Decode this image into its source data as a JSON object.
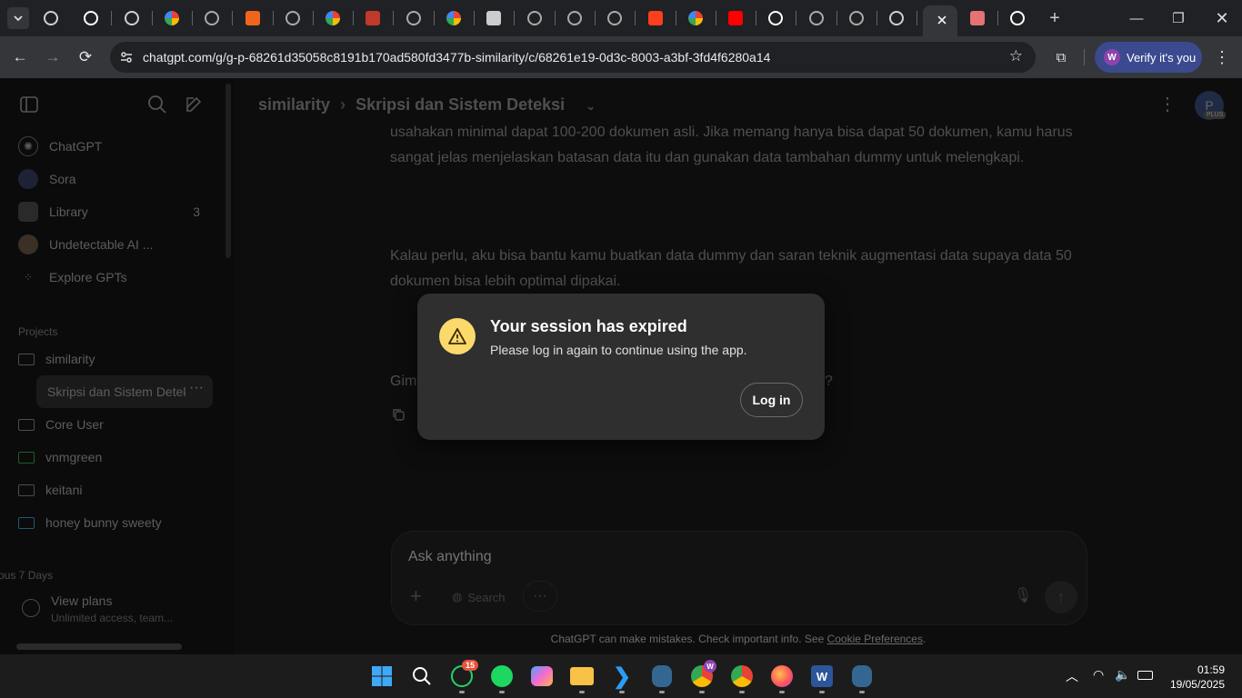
{
  "browser": {
    "url": "chatgpt.com/g/g-p-68261d35058c8191b170ad580fd3477b-similarity/c/68261e19-0d3c-8003-a3bf-3fd4f6280a14",
    "verify_label": "Verify it's you",
    "verify_avatar": "W",
    "tabs": [
      {
        "icon": "chatgpt-icon"
      },
      {
        "icon": "github-icon"
      },
      {
        "icon": "chatgpt-icon"
      },
      {
        "icon": "google-icon"
      },
      {
        "icon": "globe-icon"
      },
      {
        "icon": "etsy-icon",
        "text": "E"
      },
      {
        "icon": "globe-icon"
      },
      {
        "icon": "google-icon"
      },
      {
        "icon": "red-tower-icon"
      },
      {
        "icon": "globe-icon"
      },
      {
        "icon": "google-icon"
      },
      {
        "icon": "app-icon"
      },
      {
        "icon": "globe-icon"
      },
      {
        "icon": "globe-icon"
      },
      {
        "icon": "globe-icon"
      },
      {
        "icon": "yandex-icon",
        "text": "Y"
      },
      {
        "icon": "google-icon"
      },
      {
        "icon": "youtube-icon"
      },
      {
        "icon": "tiktok-icon"
      },
      {
        "icon": "globe-icon"
      },
      {
        "icon": "globe-icon"
      },
      {
        "icon": "chatgpt-icon"
      },
      {
        "icon": "close-icon",
        "active": true
      },
      {
        "icon": "gallery-icon"
      },
      {
        "icon": "github-icon"
      }
    ]
  },
  "sidebar": {
    "items": [
      {
        "label": "ChatGPT",
        "icon": "chatgpt-icon"
      },
      {
        "label": "Sora",
        "icon": "sora-icon"
      },
      {
        "label": "Library",
        "icon": "library-icon",
        "count": "3"
      },
      {
        "label": "Undetectable AI ...",
        "icon": "avatar-icon"
      },
      {
        "label": "Explore GPTs",
        "icon": "grid-icon"
      }
    ],
    "projects_heading": "Projects",
    "projects": [
      {
        "label": "similarity",
        "color": "#4d4d4d"
      },
      {
        "label": "Skripsi dan Sistem Detek",
        "active": true
      },
      {
        "label": "Core User",
        "color": "#4d4d4d"
      },
      {
        "label": "vnmgreen",
        "color": "#1e5e2e"
      },
      {
        "label": "keitani",
        "color": "#4d4d4d"
      },
      {
        "label": "honey bunny sweety",
        "color": "#1d5a70"
      }
    ],
    "recent_heading": "ous 7 Days",
    "view_plans": "View plans",
    "view_plans_sub": "Unlimited access, team..."
  },
  "header": {
    "project": "similarity",
    "chat_title": "Skripsi dan Sistem Deteksi",
    "avatar": "P",
    "badge": "PLUS"
  },
  "messages": {
    "m1_line1": "usahakan minimal dapat 100-200 dokumen asli. Jika memang hanya bisa dapat 50 dokumen, kamu harus",
    "m1_line2": "sangat jelas menjelaskan batasan data itu dan gunakan data tambahan dummy untuk melengkapi.",
    "m2": "Kalau perlu, aku bisa bantu kamu buatkan data dummy dan saran teknik augmentasi data supaya data 50 dokumen bisa lebih optimal dipakai.",
    "m3_start": "Gim",
    "m3_end": "?"
  },
  "composer": {
    "placeholder": "Ask anything",
    "search_label": "Search"
  },
  "footer": {
    "text": "ChatGPT can make mistakes. Check important info. See ",
    "link": "Cookie Preferences",
    "end": "."
  },
  "modal": {
    "title": "Your session has expired",
    "body": "Please log in again to continue using the app.",
    "button": "Log in",
    "icon_color": "#fbd96b"
  },
  "taskbar": {
    "whatsapp_badge": "15",
    "chrome_profile_badge": "W",
    "time": "01:59",
    "date": "19/05/2025"
  }
}
